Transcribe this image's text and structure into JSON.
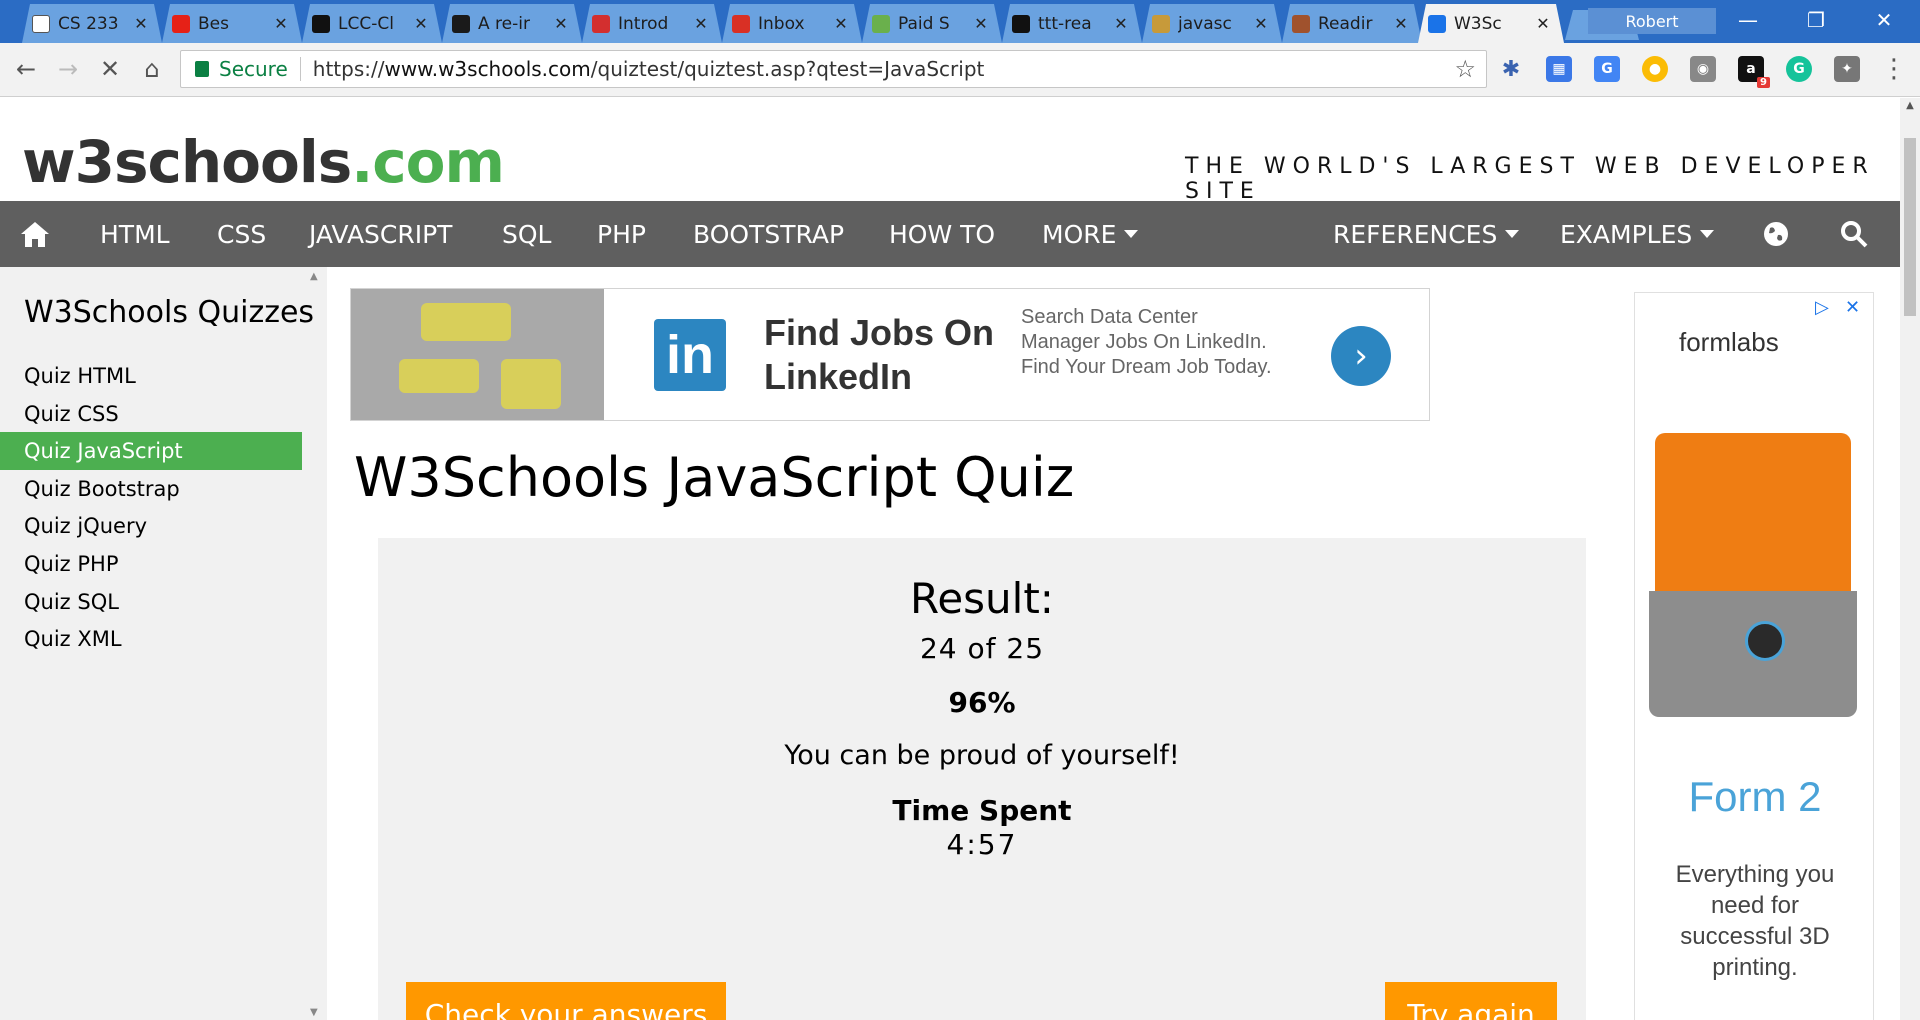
{
  "browser": {
    "tabs": [
      {
        "label": "CS 233",
        "icon": "document-icon",
        "icon_color": "#ffffff"
      },
      {
        "label": "Bes",
        "icon": "youtube-icon",
        "icon_color": "#e62117"
      },
      {
        "label": "LCC-Cl",
        "icon": "github-icon",
        "icon_color": "#111111"
      },
      {
        "label": "A re-ir",
        "icon": "bird-icon",
        "icon_color": "#1a1a1a"
      },
      {
        "label": "Introd",
        "icon": "z-icon",
        "icon_color": "#d32f2f"
      },
      {
        "label": "Inbox",
        "icon": "gmail-icon",
        "icon_color": "#d93025"
      },
      {
        "label": "Paid S",
        "icon": "fiverr-icon",
        "icon_color": "#6ab04c"
      },
      {
        "label": "ttt-rea",
        "icon": "github-icon",
        "icon_color": "#111111"
      },
      {
        "label": "javasc",
        "icon": "hand-icon",
        "icon_color": "#c79a3a"
      },
      {
        "label": "Readir",
        "icon": "reading-icon",
        "icon_color": "#a0522d"
      },
      {
        "label": "W3Sc",
        "icon": "loading-icon",
        "icon_color": "#1a73e8",
        "active": true
      }
    ],
    "profile_name": "Robert",
    "secure_label": "Secure",
    "url_prefix": "https://",
    "url_domain": "www.w3schools.com",
    "url_path": "/quiztest/quiztest.asp?qtest=JavaScript",
    "extension_badge": "9"
  },
  "site": {
    "logo_main": "w3schools",
    "logo_tld": ".com",
    "tagline": "THE WORLD'S LARGEST WEB DEVELOPER SITE",
    "nav": [
      "HTML",
      "CSS",
      "JAVASCRIPT",
      "SQL",
      "PHP",
      "BOOTSTRAP",
      "HOW TO",
      "MORE"
    ],
    "nav_right": [
      "REFERENCES",
      "EXAMPLES"
    ]
  },
  "sidebar": {
    "title": "W3Schools Quizzes",
    "items": [
      "Quiz HTML",
      "Quiz CSS",
      "Quiz JavaScript",
      "Quiz Bootstrap",
      "Quiz jQuery",
      "Quiz PHP",
      "Quiz SQL",
      "Quiz XML"
    ],
    "active_index": 2
  },
  "ad_top": {
    "logo_text": "in",
    "headline": "Find Jobs On LinkedIn",
    "body": "Search Data Center Manager Jobs On LinkedIn. Find Your Dream Job Today."
  },
  "main": {
    "title": "W3Schools JavaScript Quiz",
    "result_title": "Result:",
    "score": "24 of 25",
    "percent": "96%",
    "message": "You can be proud of yourself!",
    "time_label": "Time Spent",
    "time_value": "4:57",
    "check_button": "Check your answers",
    "retry_button": "Try again"
  },
  "ad_right": {
    "brand": "formlabs",
    "product": "Form 2",
    "description": "Everything you need for successful 3D printing."
  },
  "colors": {
    "accent_green": "#4caf50",
    "nav_gray": "#5f5f5f",
    "button_orange": "#ff9800",
    "chrome_blue": "#2b6cc4"
  }
}
